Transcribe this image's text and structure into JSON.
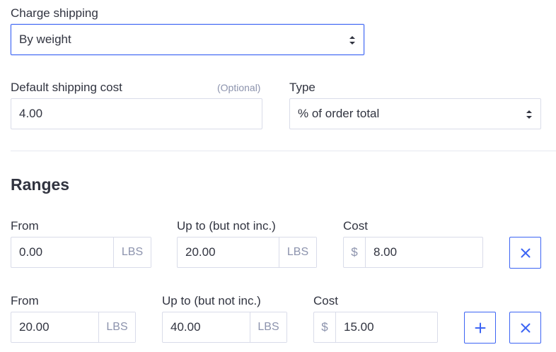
{
  "charge_shipping": {
    "label": "Charge shipping",
    "value": "By weight"
  },
  "default_cost": {
    "label": "Default shipping cost",
    "optional": "(Optional)",
    "value": "4.00"
  },
  "type": {
    "label": "Type",
    "value": "% of order total"
  },
  "ranges": {
    "heading": "Ranges",
    "rows": [
      {
        "from_label": "From",
        "from_value": "0.00",
        "from_unit": "LBS",
        "upto_label": "Up to (but not inc.)",
        "upto_value": "20.00",
        "upto_unit": "LBS",
        "cost_label": "Cost",
        "currency": "$",
        "cost_value": "8.00"
      },
      {
        "from_label": "From",
        "from_value": "20.00",
        "from_unit": "LBS",
        "upto_label": "Up to (but not inc.)",
        "upto_value": "40.00",
        "upto_unit": "LBS",
        "cost_label": "Cost",
        "currency": "$",
        "cost_value": "15.00"
      }
    ]
  },
  "icons": {
    "remove": "close-icon",
    "add": "plus-icon",
    "select": "chevron-up-down-icon"
  },
  "colors": {
    "accent": "#3c64f4",
    "text": "#313440",
    "muted": "#8c93ad",
    "border": "#d9dce9"
  }
}
